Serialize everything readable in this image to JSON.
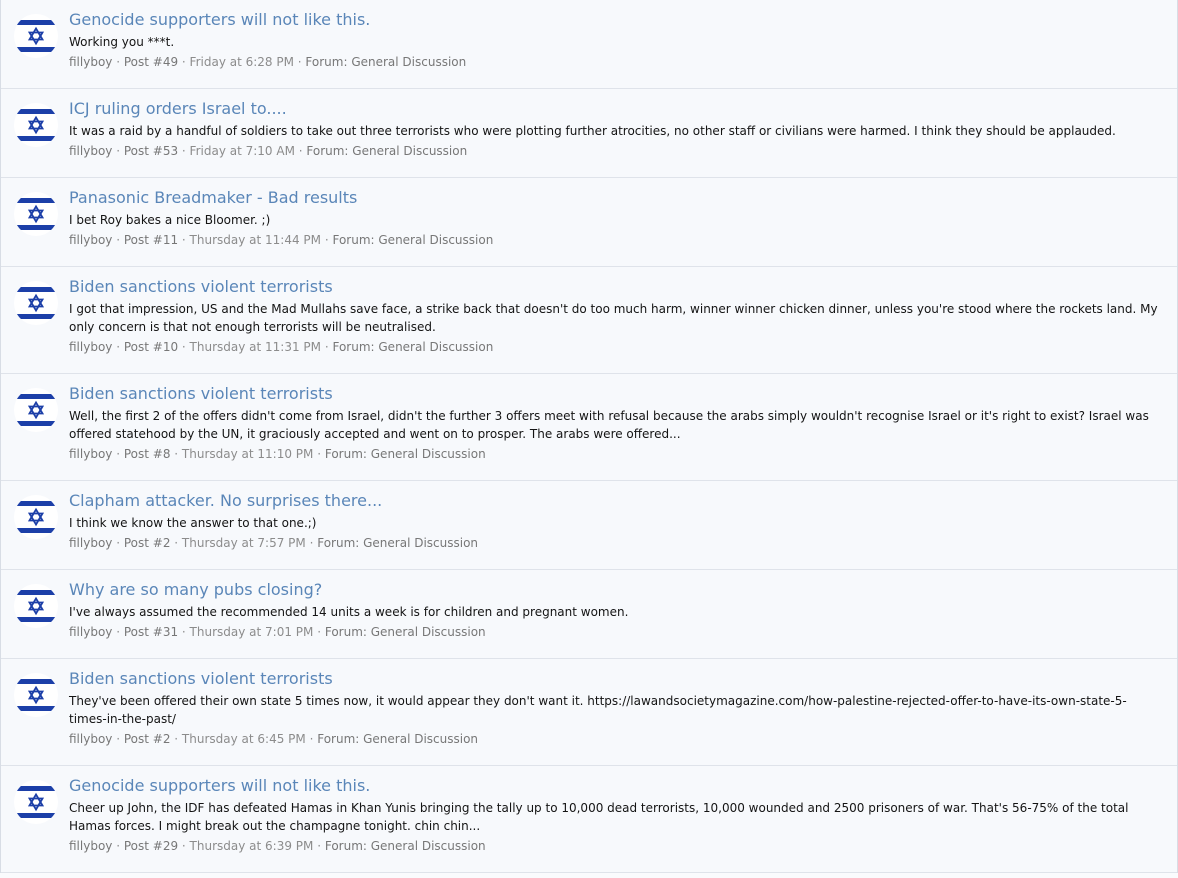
{
  "results": [
    {
      "title": "Genocide supporters will not like this.",
      "snippet": "Working you ***t.",
      "user": "fillyboy",
      "post": "Post #49",
      "time": "Friday at 6:28 PM",
      "forum": "Forum: General Discussion"
    },
    {
      "title": "ICJ ruling orders Israel to....",
      "snippet": "It was a raid by a handful of soldiers to take out three terrorists who were plotting further atrocities, no other staff or civilians were harmed. I think they should be applauded.",
      "user": "fillyboy",
      "post": "Post #53",
      "time": "Friday at 7:10 AM",
      "forum": "Forum: General Discussion"
    },
    {
      "title": "Panasonic Breadmaker - Bad results",
      "snippet": "I bet Roy bakes a nice Bloomer. ;)",
      "user": "fillyboy",
      "post": "Post #11",
      "time": "Thursday at 11:44 PM",
      "forum": "Forum: General Discussion"
    },
    {
      "title": "Biden sanctions violent terrorists",
      "snippet": "I got that impression, US and the Mad Mullahs save face, a strike back that doesn't do too much harm, winner winner chicken dinner, unless you're stood where the rockets land. My only concern is that not enough terrorists will be neutralised.",
      "user": "fillyboy",
      "post": "Post #10",
      "time": "Thursday at 11:31 PM",
      "forum": "Forum: General Discussion"
    },
    {
      "title": "Biden sanctions violent terrorists",
      "snippet": "Well, the first 2 of the offers didn't come from Israel, didn't the further 3 offers meet with refusal because the arabs simply wouldn't recognise Israel or it's right to exist? Israel was offered statehood by the UN, it graciously accepted and went on to prosper. The arabs were offered...",
      "user": "fillyboy",
      "post": "Post #8",
      "time": "Thursday at 11:10 PM",
      "forum": "Forum: General Discussion"
    },
    {
      "title": "Clapham attacker. No surprises there...",
      "snippet": "I think we know the answer to that one.;)",
      "user": "fillyboy",
      "post": "Post #2",
      "time": "Thursday at 7:57 PM",
      "forum": "Forum: General Discussion"
    },
    {
      "title": "Why are so many pubs closing?",
      "snippet": "I've always assumed the recommended 14 units a week is for children and pregnant women.",
      "user": "fillyboy",
      "post": "Post #31",
      "time": "Thursday at 7:01 PM",
      "forum": "Forum: General Discussion"
    },
    {
      "title": "Biden sanctions violent terrorists",
      "snippet": "They've been offered their own state 5 times now, it would appear they don't want it. https://lawandsocietymagazine.com/how-palestine-rejected-offer-to-have-its-own-state-5-times-in-the-past/",
      "user": "fillyboy",
      "post": "Post #2",
      "time": "Thursday at 6:45 PM",
      "forum": "Forum: General Discussion"
    },
    {
      "title": "Genocide supporters will not like this.",
      "snippet": "Cheer up John, the IDF has defeated Hamas in Khan Yunis bringing the tally up to 10,000 dead terrorists, 10,000 wounded and 2500 prisoners of war. That's 56-75% of the total Hamas forces. I might break out the champagne tonight. chin chin...",
      "user": "fillyboy",
      "post": "Post #29",
      "time": "Thursday at 6:39 PM",
      "forum": "Forum: General Discussion"
    }
  ],
  "separator": " · ",
  "avatar_icon": "israel-flag-avatar-icon",
  "colors": {
    "title": "#5a86b8",
    "flag_blue": "#1c3fa8",
    "meta": "#8c8c8c"
  }
}
